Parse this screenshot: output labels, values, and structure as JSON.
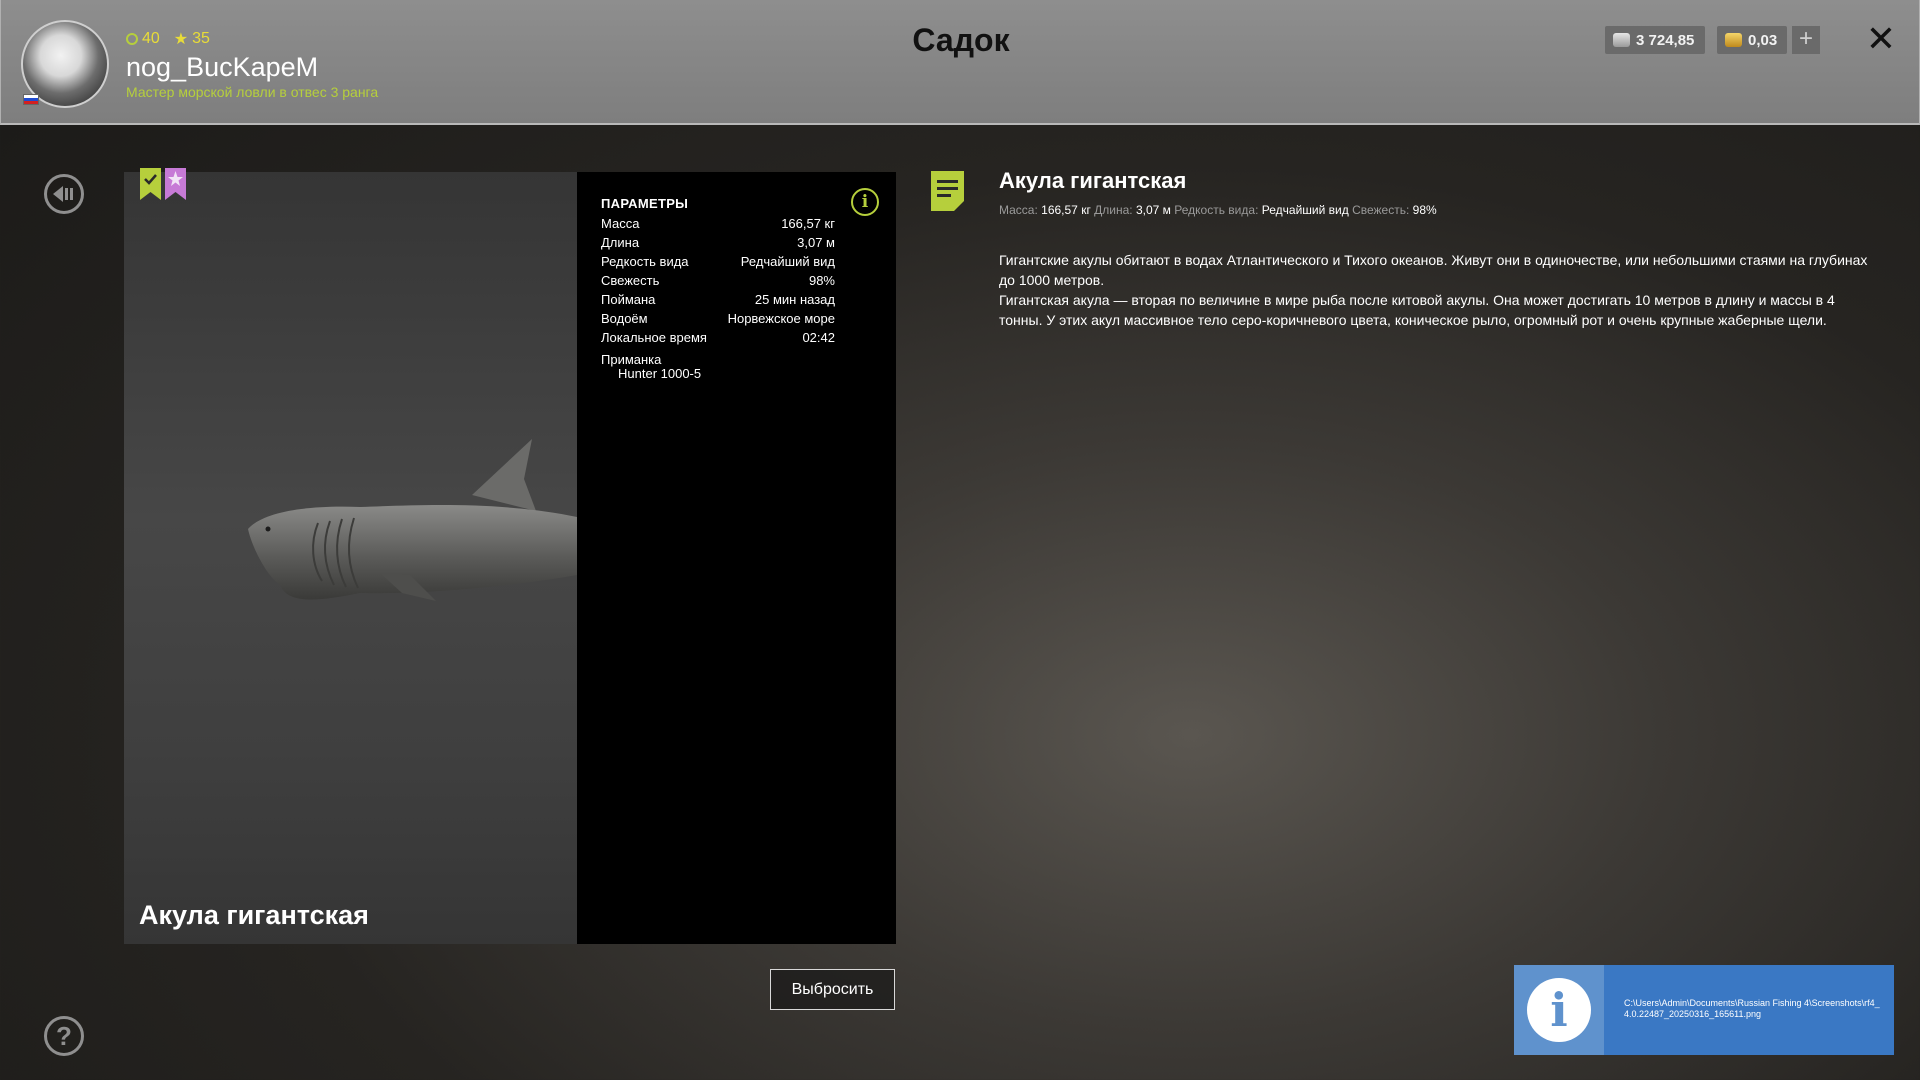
{
  "header": {
    "title": "Садок",
    "player": {
      "level": "40",
      "stars": "35",
      "username": "nog_BucKapeM",
      "rank": "Мастер морской ловли в отвес 3 ранга"
    },
    "currency": {
      "silver": "3 724,85",
      "gold": "0,03",
      "add_label": "+"
    },
    "close_label": "✕"
  },
  "fish": {
    "name": "Акула гигантская",
    "params_title": "ПАРАМЕТРЫ",
    "params": [
      {
        "label": "Масса",
        "value": "166,57 кг"
      },
      {
        "label": "Длина",
        "value": "3,07 м"
      },
      {
        "label": "Редкость вида",
        "value": "Редчайший вид"
      },
      {
        "label": "Свежесть",
        "value": "98%"
      },
      {
        "label": "Поймана",
        "value": "25 мин назад"
      },
      {
        "label": "Водоём",
        "value": "Норвежское море"
      },
      {
        "label": "Локальное время",
        "value": "02:42"
      }
    ],
    "bait_label": "Приманка",
    "bait_value": "Hunter 1000-5",
    "discard_label": "Выбросить"
  },
  "description": {
    "title": "Акула гигантская",
    "stats": {
      "mass_label": "Масса:",
      "mass_value": "166,57 кг",
      "length_label": "Длина:",
      "length_value": "3,07 м",
      "rarity_label": "Редкость вида:",
      "rarity_value": "Редчайший вид",
      "freshness_label": "Свежесть:",
      "freshness_value": "98%"
    },
    "paragraph1": "Гигантские акулы обитают в водах Атлантического и Тихого океанов. Живут они в одиночестве, или небольшими стаями на глубинах до 1000 метров.",
    "paragraph2": "Гигантская акула — вторая по величине в мире рыба после китовой акулы. Она может достигать 10 метров в длину и массы в 4 тонны. У этих акул массивное тело серо-коричневого цвета, коническое рыло, огромный рот и очень крупные жаберные щели."
  },
  "toast": {
    "path": "C:\\Users\\Admin\\Documents\\Russian Fishing 4\\Screenshots\\rf4_4.0.22487_20250316_165611.png"
  },
  "colors": {
    "accent_green": "#b6cf3c",
    "header_bg": "#878787",
    "toast_bg": "#3a78c4",
    "badge_pink": "#c77ad6"
  },
  "icons": {
    "back": "back-icon",
    "help": "help-icon",
    "info": "info-icon",
    "note": "note-icon",
    "close": "close-icon"
  }
}
